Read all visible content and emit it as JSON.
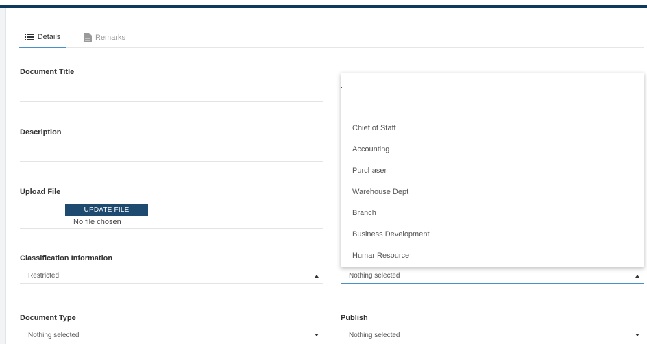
{
  "tabs": [
    {
      "label": "Details",
      "icon": "list-icon",
      "active": true
    },
    {
      "label": "Remarks",
      "icon": "document-icon",
      "active": false
    }
  ],
  "form": {
    "document_title_label": "Document Title",
    "description_label": "Description",
    "upload_file_label": "Upload File",
    "upload_button_label": "UPDATE FILE",
    "no_file_text": "No file chosen",
    "classification_label": "Classification Information",
    "classification_value": "Restricted",
    "department_value": "Nothing selected",
    "document_type_label": "Document Type",
    "document_type_value": "Nothing selected",
    "publish_label": "Publish",
    "publish_value": "Nothing selected"
  },
  "dropdown": {
    "search_value": "",
    "options": [
      "Chief of Staff",
      "Accounting",
      "Purchaser",
      "Warehouse Dept",
      "Branch",
      "Business Development",
      "Humar Resource"
    ]
  },
  "colors": {
    "accent": "#4a90c8",
    "button_bg": "#1e4a70",
    "top_bar": "#0e3a5c"
  }
}
